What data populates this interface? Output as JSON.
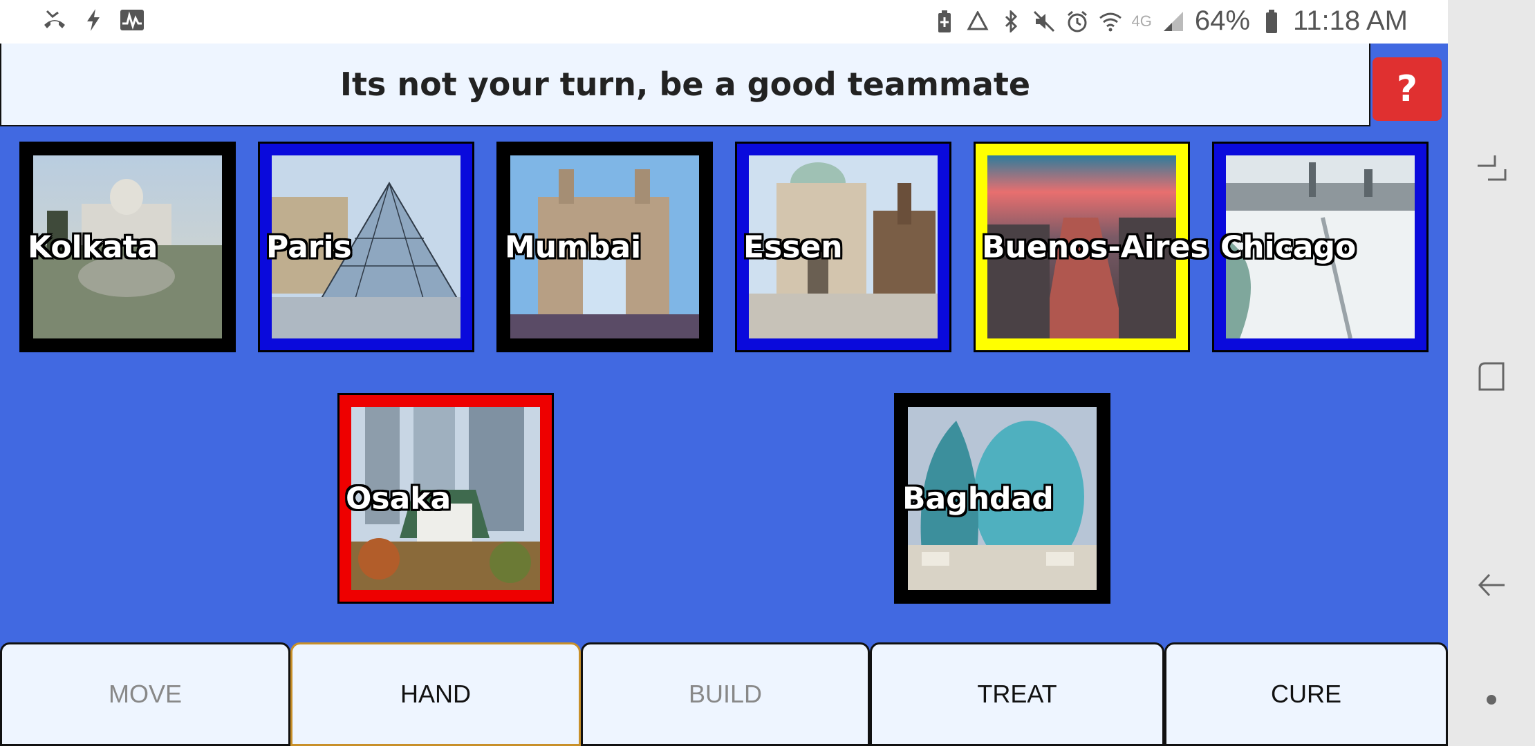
{
  "status_bar": {
    "battery_percent": "64%",
    "time": "11:18 AM",
    "network": "4G",
    "left_icons": [
      "missed-call-icon",
      "flash-icon",
      "activity-icon"
    ],
    "right_icons": [
      "battery-saver-icon",
      "recycle-icon",
      "bluetooth-icon",
      "mute-icon",
      "alarm-icon",
      "wifi-icon",
      "signal-icon",
      "battery-icon"
    ]
  },
  "banner": {
    "message": "Its not your turn, be a good teammate",
    "help_label": "?"
  },
  "cities": [
    {
      "name": "Kolkata",
      "border_color": "#000000"
    },
    {
      "name": "Paris",
      "border_color": "#0a0adc"
    },
    {
      "name": "Mumbai",
      "border_color": "#000000"
    },
    {
      "name": "Essen",
      "border_color": "#0a0adc"
    },
    {
      "name": "Buenos-Aires",
      "border_color": "#ffff00"
    },
    {
      "name": "Chicago",
      "border_color": "#0a0adc"
    },
    {
      "name": "Osaka",
      "border_color": "#ee0000"
    },
    {
      "name": "Baghdad",
      "border_color": "#000000"
    }
  ],
  "actions": [
    {
      "label": "MOVE",
      "enabled": false
    },
    {
      "label": "HAND",
      "enabled": true,
      "selected": true
    },
    {
      "label": "BUILD",
      "enabled": false
    },
    {
      "label": "TREAT",
      "enabled": true
    },
    {
      "label": "CURE",
      "enabled": true
    }
  ],
  "colors": {
    "background": "#4169e1",
    "panel": "#eef5ff",
    "help_button": "#e03030"
  }
}
